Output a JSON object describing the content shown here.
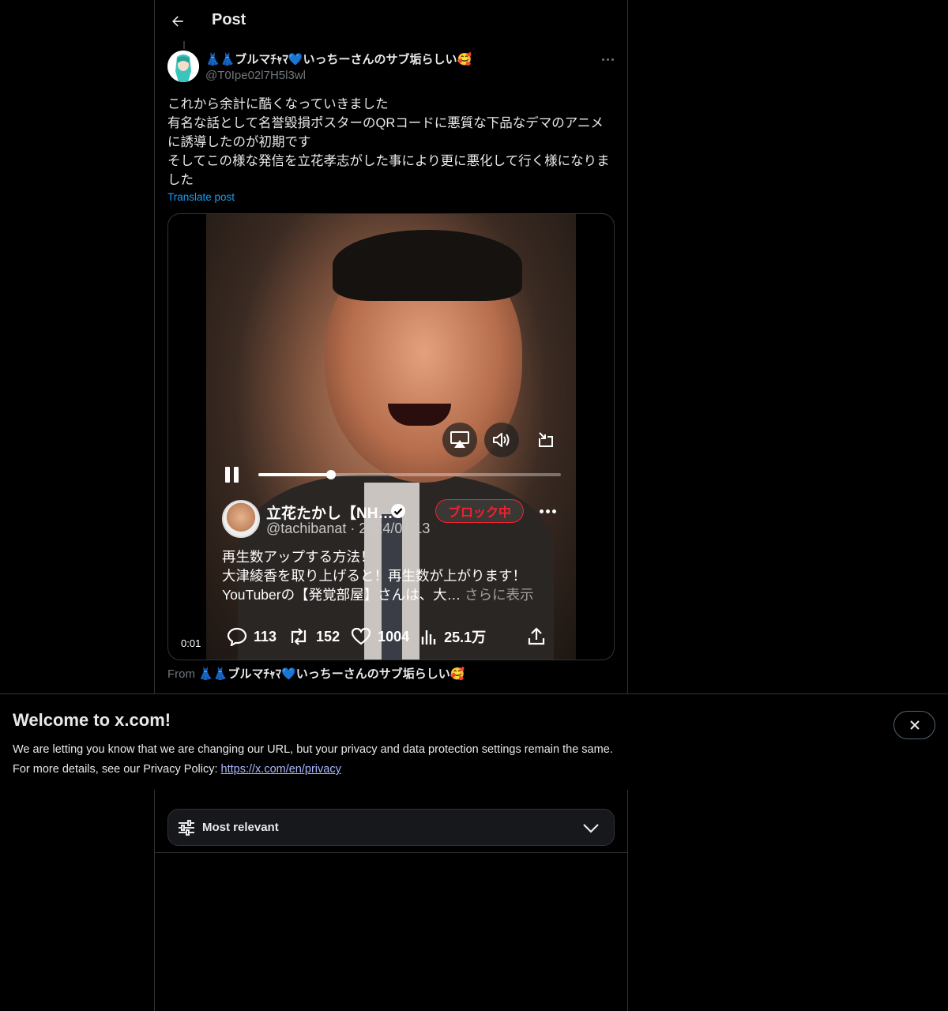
{
  "header": {
    "title": "Post"
  },
  "post": {
    "author_name": "👗👗ブルマﾁｬﾏ💙いっちーさんのサブ垢らしい🥰",
    "author_handle": "@T0Ipe02l7H5l3wl",
    "text_lines": [
      "これから余計に酷くなっていきました",
      "有名な話として名誉毀損ポスターのQRコードに悪質な下品なデマのアニメに誘導したのが初期です",
      "そしてこの様な発信を立花孝志がした事により更に悪化して行く様になりました"
    ],
    "translate_label": "Translate post",
    "from_label": "From",
    "from_name": "👗👗ブルマﾁｬﾏ💙いっちーさんのサブ垢らしい🥰"
  },
  "video": {
    "timestamp": "0:01",
    "progress": 0.24,
    "embedded": {
      "name": "立花たかし【NH…",
      "handle_date": "@tachibanat · 2024/07/13",
      "block_label": "ブロック中",
      "text_lines": [
        "再生数アップする方法！",
        "大津綾香を取り上げると！再生数が上がります！",
        "YouTuberの【発覚部屋】さんは、大…"
      ],
      "show_more": " さらに表示",
      "replies": "113",
      "reposts": "152",
      "likes": "1004",
      "views": "25.1万"
    }
  },
  "sort": {
    "label": "Most relevant"
  },
  "banner": {
    "title": "Welcome to x.com!",
    "line1": "We are letting you know that we are changing our URL, but your privacy and data protection settings remain the same.",
    "line2_prefix": "For more details, see our Privacy Policy: ",
    "link": "https://x.com/en/privacy"
  },
  "colors": {
    "accent": "#1d9bf0",
    "block_red": "#f4212e",
    "background": "#000000"
  }
}
